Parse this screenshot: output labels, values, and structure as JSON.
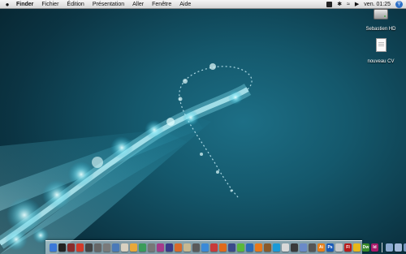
{
  "menubar": {
    "apple_icon": "apple-icon",
    "app_name": "Finder",
    "menus": [
      "Fichier",
      "Édition",
      "Présentation",
      "Aller",
      "Fenêtre",
      "Aide"
    ],
    "clock": "ven. 01:25",
    "status_icons": [
      "bluetooth-icon",
      "wifi-icon",
      "volume-icon",
      "spotlight-icon"
    ]
  },
  "desktop_icons": [
    {
      "label": "Sebastien HD",
      "icon": "hard-drive-icon"
    },
    {
      "label": "nouveau CV",
      "icon": "document-icon"
    }
  ],
  "dock": {
    "apps": [
      {
        "icon": "finder-icon",
        "color": "#3b78d8"
      },
      {
        "icon": "dashboard-icon",
        "color": "#222222"
      },
      {
        "icon": "app-icon",
        "color": "#8a2c2c"
      },
      {
        "icon": "app-icon",
        "color": "#d23a2a"
      },
      {
        "icon": "photo-booth-icon",
        "color": "#444444"
      },
      {
        "icon": "app-icon",
        "color": "#666666"
      },
      {
        "icon": "app-icon",
        "color": "#7a7a7a"
      },
      {
        "icon": "app-icon",
        "color": "#4a7ab8"
      },
      {
        "icon": "app-icon",
        "color": "#d8d0c0"
      },
      {
        "icon": "app-icon",
        "color": "#e8a83a"
      },
      {
        "icon": "app-icon",
        "color": "#3a9c5a"
      },
      {
        "icon": "app-icon",
        "color": "#777777"
      },
      {
        "icon": "app-icon",
        "color": "#a53a8a"
      },
      {
        "icon": "app-icon",
        "color": "#3a3a8a"
      },
      {
        "icon": "app-icon",
        "color": "#d86a2a"
      },
      {
        "icon": "app-icon",
        "color": "#c8b890"
      },
      {
        "icon": "app-icon",
        "color": "#5a5a5a"
      },
      {
        "icon": "safari-icon",
        "color": "#3a8ad8"
      },
      {
        "icon": "app-icon",
        "color": "#c83a3a"
      },
      {
        "icon": "app-icon",
        "color": "#e06a1a"
      },
      {
        "icon": "app-icon",
        "color": "#3a4a8a"
      },
      {
        "icon": "app-icon",
        "color": "#5ab83a"
      },
      {
        "icon": "app-icon",
        "color": "#2a6ab8"
      },
      {
        "icon": "firefox-icon",
        "color": "#e8781a"
      },
      {
        "icon": "app-icon",
        "color": "#8a5a2a"
      },
      {
        "icon": "skype-icon",
        "color": "#1a9ad8"
      },
      {
        "icon": "app-icon",
        "color": "#d8d8d8"
      },
      {
        "icon": "app-icon",
        "color": "#3a3a3a"
      },
      {
        "icon": "app-icon",
        "color": "#6a8ac8"
      },
      {
        "icon": "app-icon",
        "color": "#555555"
      },
      {
        "icon": "illustrator-icon",
        "color": "#e8801a",
        "text": "Ai"
      },
      {
        "icon": "photoshop-icon",
        "color": "#1a5ab8",
        "text": "Ps"
      },
      {
        "icon": "app-icon",
        "color": "#c8c8c8"
      },
      {
        "icon": "flash-icon",
        "color": "#b81a1a",
        "text": "Fl"
      },
      {
        "icon": "app-icon",
        "color": "#e8b81a"
      },
      {
        "icon": "dreamweaver-icon",
        "color": "#3a8a2a",
        "text": "Dw"
      },
      {
        "icon": "indesign-icon",
        "color": "#a81a6a",
        "text": "Id"
      }
    ],
    "stacks": [
      {
        "icon": "downloads-stack-icon",
        "color": "#8aaad0"
      },
      {
        "icon": "documents-stack-icon",
        "color": "#a0b8d8"
      },
      {
        "icon": "applications-stack-icon",
        "color": "#7898c0"
      },
      {
        "icon": "trash-icon",
        "color": "#c8d0d8"
      }
    ]
  }
}
